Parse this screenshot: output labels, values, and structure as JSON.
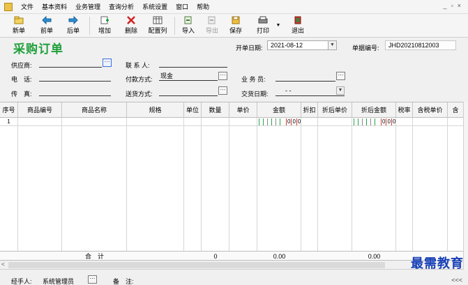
{
  "menubar": {
    "items": [
      "文件",
      "基本资料",
      "业务管理",
      "查询分析",
      "系统设置",
      "窗口",
      "帮助"
    ],
    "window_controls": [
      "_",
      "▫",
      "×"
    ]
  },
  "toolbar": {
    "buttons": [
      {
        "label": "新单",
        "icon": "new-doc-icon",
        "disabled": false
      },
      {
        "label": "前单",
        "icon": "prev-arrow-icon",
        "disabled": false
      },
      {
        "label": "后单",
        "icon": "next-arrow-icon",
        "disabled": false
      },
      {
        "label": "增加",
        "icon": "add-row-icon",
        "disabled": false
      },
      {
        "label": "删除",
        "icon": "delete-x-icon",
        "disabled": false
      },
      {
        "label": "配置列",
        "icon": "config-columns-icon",
        "disabled": false
      },
      {
        "label": "导入",
        "icon": "import-icon",
        "disabled": false
      },
      {
        "label": "导出",
        "icon": "export-icon",
        "disabled": true
      },
      {
        "label": "保存",
        "icon": "save-icon",
        "disabled": false
      },
      {
        "label": "打印",
        "icon": "printer-icon",
        "disabled": false
      },
      {
        "label": "退出",
        "icon": "exit-icon",
        "disabled": false
      }
    ]
  },
  "form": {
    "title": "采购订单",
    "order_date_label": "开单日期:",
    "order_date_value": "2021-08-12",
    "doc_no_label": "单据编号:",
    "doc_no_value": "JHD20210812003",
    "supplier_label": "供应商:",
    "supplier_value": "",
    "contact_label": "联 系 人:",
    "contact_value": "",
    "phone_label": "电　话:",
    "phone_value": "",
    "payment_label": "付款方式:",
    "payment_value": "现金",
    "salesman_label": "业 务 员:",
    "salesman_value": "",
    "fax_label": "传　真:",
    "fax_value": "",
    "delivery_label": "送货方式:",
    "delivery_value": "",
    "delivery_date_label": "交货日期:",
    "delivery_date_value": "- -",
    "ellipsis": "···"
  },
  "grid": {
    "columns": [
      "序号",
      "商品编号",
      "商品名称",
      "规格",
      "单位",
      "数量",
      "单价",
      "金额",
      "折扣",
      "折后单价",
      "折后金额",
      "税率",
      "含税单价",
      "含"
    ],
    "rows": [
      {
        "index": "1",
        "amount_digits": [
          "0",
          "0",
          "0"
        ],
        "net_amount_digits": [
          "0",
          "0",
          "0"
        ]
      }
    ],
    "totals": {
      "label": "合　计",
      "quantity": "0",
      "amount": "0.00",
      "net_amount": "0.00"
    }
  },
  "footer": {
    "handler_label": "经手人:",
    "handler_value": "系统管理员",
    "remark_label": "备　注:",
    "collapse_label": "<<<",
    "ellipsis": "···"
  },
  "watermark": "最需教育",
  "colors": {
    "title_green": "#1e9f3a",
    "watermark_blue": "#1840b8",
    "tick_green": "#27a34a",
    "tick_red": "#d0403a"
  }
}
